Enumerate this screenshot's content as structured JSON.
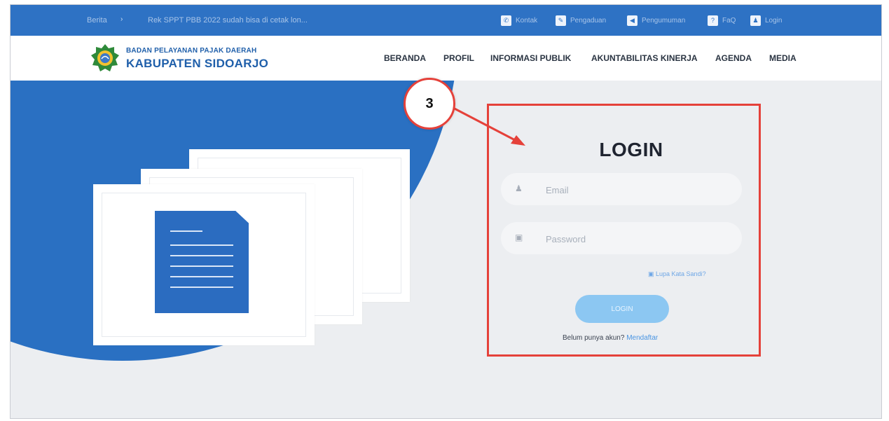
{
  "topbar": {
    "news_label": "Berita",
    "news_text": "Rek SPPT PBB 2022 sudah bisa di cetak lon...",
    "links": [
      {
        "icon": "phone-icon",
        "glyph": "✆",
        "label": "Kontak"
      },
      {
        "icon": "pencil-icon",
        "glyph": "✎",
        "label": "Pengaduan"
      },
      {
        "icon": "megaphone-icon",
        "glyph": "◀",
        "label": "Pengumuman"
      },
      {
        "icon": "question-icon",
        "glyph": "?",
        "label": "FaQ"
      },
      {
        "icon": "user-icon",
        "glyph": "♟",
        "label": "Login"
      }
    ]
  },
  "header": {
    "brand_line1": "BADAN PELAYANAN PAJAK DAERAH",
    "brand_line2": "KABUPATEN SIDOARJO",
    "menu": [
      "BERANDA",
      "PROFIL",
      "INFORMASI PUBLIK",
      "AKUNTABILITAS KINERJA",
      "AGENDA",
      "MEDIA"
    ]
  },
  "login": {
    "title": "LOGIN",
    "email_placeholder": "Email",
    "password_placeholder": "Password",
    "forgot": "Lupa Kata Sandi?",
    "button": "LOGIN",
    "register_prompt": "Belum punya akun?",
    "register_link": "Mendaftar"
  },
  "annotation": {
    "step_number": "3",
    "color": "#e5413a"
  },
  "colors": {
    "primary": "#2e72c4",
    "button": "#8cc7f2"
  }
}
